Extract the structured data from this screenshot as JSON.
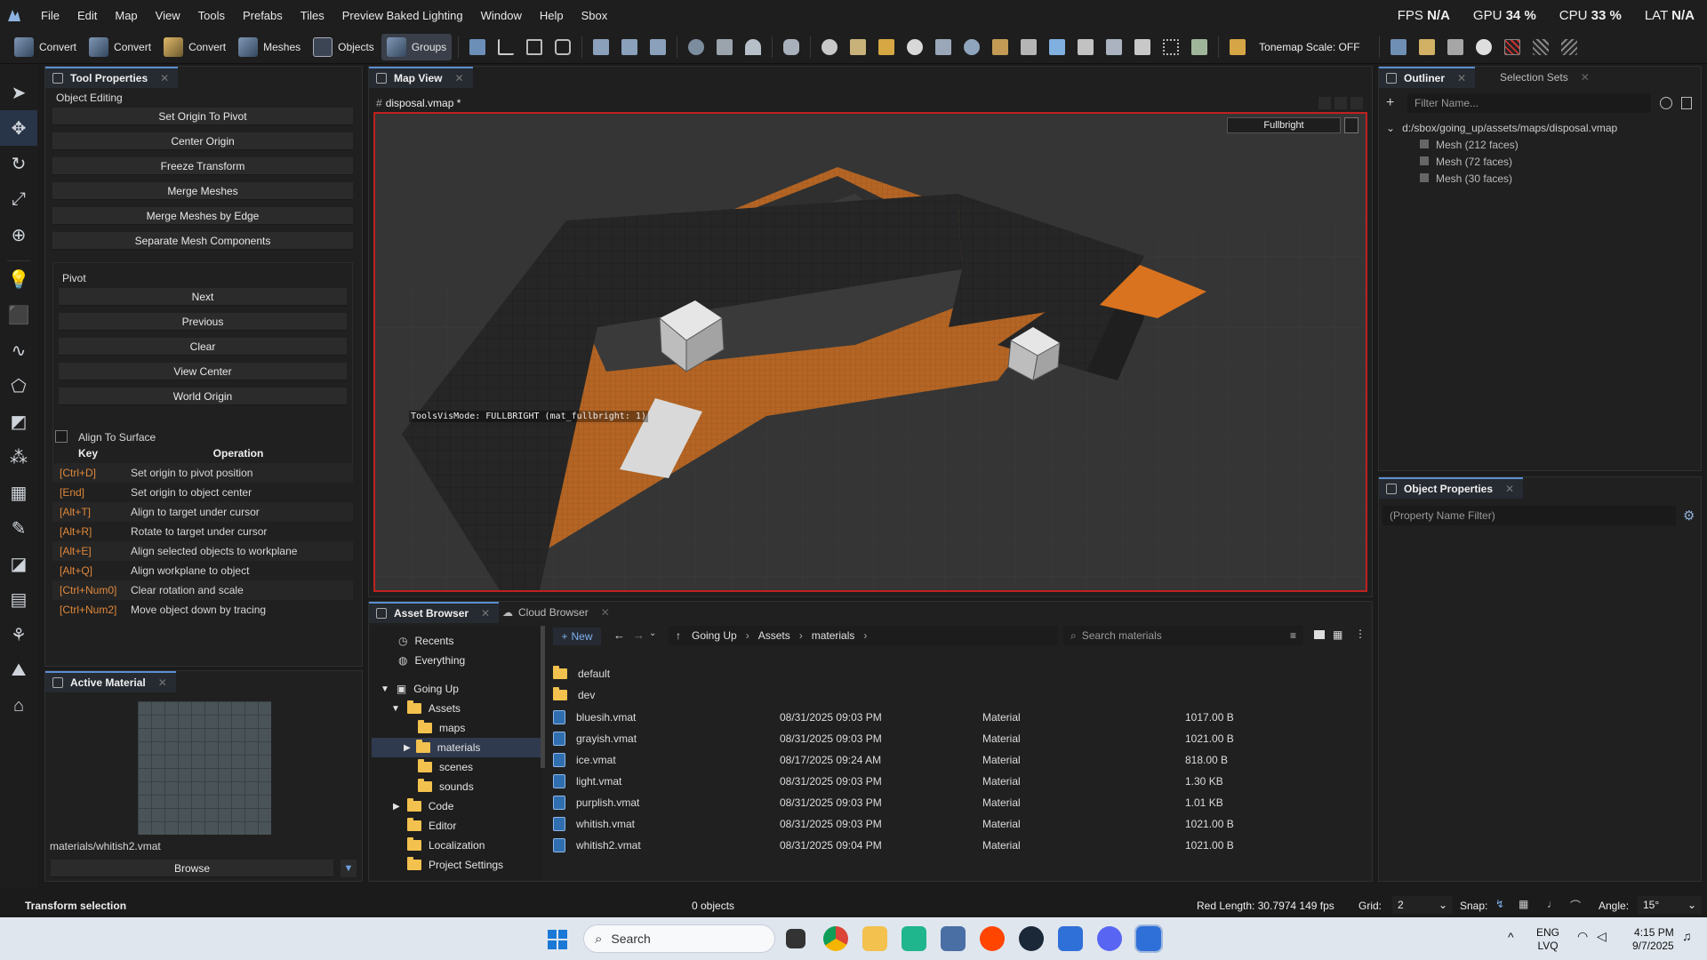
{
  "menu": [
    "File",
    "Edit",
    "Map",
    "View",
    "Tools",
    "Prefabs",
    "Tiles",
    "Preview Baked Lighting",
    "Window",
    "Help",
    "Sbox"
  ],
  "stats": {
    "fps_label": "FPS",
    "fps_value": "N/A",
    "gpu_label": "GPU",
    "gpu_value": "34 %",
    "cpu_label": "CPU",
    "cpu_value": "33 %",
    "lat_label": "LAT",
    "lat_value": "N/A"
  },
  "toolbar": {
    "modes": [
      "Convert",
      "Convert",
      "Convert",
      "Meshes",
      "Objects",
      "Groups"
    ],
    "active_mode": "Groups",
    "tonemap": "Tonemap Scale: OFF"
  },
  "tool_properties": {
    "tab": "Tool Properties",
    "object_editing": "Object Editing",
    "buttons": [
      "Set Origin To Pivot",
      "Center Origin",
      "Freeze Transform",
      "Merge Meshes",
      "Merge Meshes by Edge",
      "Separate Mesh Components"
    ],
    "pivot_label": "Pivot",
    "pivot_buttons": [
      "Next",
      "Previous",
      "Clear",
      "View Center",
      "World Origin"
    ],
    "align_to_surface": "Align To Surface",
    "key_header": "Key",
    "op_header": "Operation",
    "shortcuts": [
      {
        "key": "[Ctrl+D]",
        "op": "Set origin to pivot position"
      },
      {
        "key": "[End]",
        "op": "Set origin to object center"
      },
      {
        "key": "[Alt+T]",
        "op": "Align to target under cursor"
      },
      {
        "key": "[Alt+R]",
        "op": "Rotate to target under cursor"
      },
      {
        "key": "[Alt+E]",
        "op": "Align selected objects to workplane"
      },
      {
        "key": "[Alt+Q]",
        "op": "Align workplane to object"
      },
      {
        "key": "[Ctrl+Num0]",
        "op": "Clear rotation and scale"
      },
      {
        "key": "[Ctrl+Num2]",
        "op": "Move object down by tracing"
      }
    ]
  },
  "active_material": {
    "tab": "Active Material",
    "path": "materials/whitish2.vmat",
    "browse": "Browse"
  },
  "map_view": {
    "tab": "Map View",
    "doc_title": "disposal.vmap *",
    "render_mode": "Fullbright",
    "overlay_text": "ToolsVisMode: FULLBRIGHT (mat_fullbright: 1)"
  },
  "outliner": {
    "tab": "Outliner",
    "tab2": "Selection Sets",
    "filter_placeholder": "Filter Name...",
    "root": "d:/sbox/going_up/assets/maps/disposal.vmap",
    "items": [
      "Mesh (212 faces)",
      "Mesh (72 faces)",
      "Mesh (30 faces)"
    ]
  },
  "object_properties": {
    "tab": "Object Properties",
    "filter_placeholder": "(Property Name Filter)"
  },
  "asset_browser": {
    "tab": "Asset Browser",
    "tab2": "Cloud Browser",
    "new_label": "New",
    "breadcrumb": [
      "Going Up",
      "Assets",
      "materials"
    ],
    "search_placeholder": "Search materials",
    "tree": {
      "recents": "Recents",
      "everything": "Everything",
      "project": "Going Up",
      "assets": "Assets",
      "folders": [
        "maps",
        "materials",
        "scenes",
        "sounds"
      ],
      "other": [
        "Code",
        "Editor",
        "Localization",
        "Project Settings"
      ]
    },
    "folders": [
      "default",
      "dev"
    ],
    "files": [
      {
        "name": "bluesih.vmat",
        "date": "08/31/2025 09:03 PM",
        "type": "Material",
        "size": "1017.00 B"
      },
      {
        "name": "grayish.vmat",
        "date": "08/31/2025 09:03 PM",
        "type": "Material",
        "size": "1021.00 B"
      },
      {
        "name": "ice.vmat",
        "date": "08/17/2025 09:24 AM",
        "type": "Material",
        "size": "818.00 B"
      },
      {
        "name": "light.vmat",
        "date": "08/31/2025 09:03 PM",
        "type": "Material",
        "size": "1.30 KB"
      },
      {
        "name": "purplish.vmat",
        "date": "08/31/2025 09:03 PM",
        "type": "Material",
        "size": "1.01 KB"
      },
      {
        "name": "whitish.vmat",
        "date": "08/31/2025 09:03 PM",
        "type": "Material",
        "size": "1021.00 B"
      },
      {
        "name": "whitish2.vmat",
        "date": "08/31/2025 09:04 PM",
        "type": "Material",
        "size": "1021.00 B"
      }
    ]
  },
  "status": {
    "left": "Transform selection",
    "center": "0 objects",
    "red_length": "Red Length: 30.7974  149 fps",
    "grid_label": "Grid:",
    "grid_value": "2",
    "snap_label": "Snap:",
    "angle_label": "Angle:",
    "angle_value": "15°"
  },
  "taskbar": {
    "search": "Search",
    "lang1": "ENG",
    "lang2": "LVQ",
    "time": "4:15 PM",
    "date": "9/7/2025"
  },
  "colors": {
    "accent": "#5a8fd0",
    "selection_border": "#c02020",
    "key_orange": "#e0873a",
    "floor_orange": "#d9731f"
  }
}
